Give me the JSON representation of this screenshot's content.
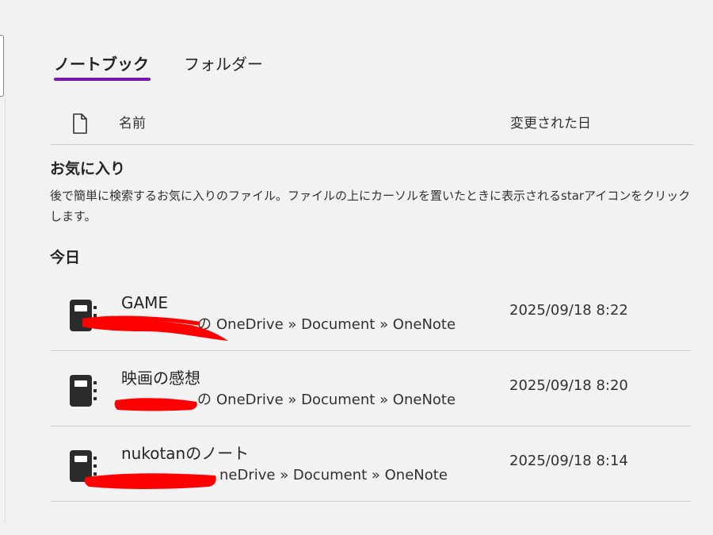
{
  "tabs": [
    {
      "label": "ノートブック",
      "active": true
    },
    {
      "label": "フォルダー",
      "active": false
    }
  ],
  "table_header": {
    "type_icon": "document-icon",
    "name_label": "名前",
    "date_label": "変更された日"
  },
  "favorites": {
    "title": "お気に入り",
    "description": "後で簡単に検索するお気に入りのファイル。ファイルの上にカーソルを置いたときに表示されるstarアイコンをクリックします。"
  },
  "today": {
    "title": "今日"
  },
  "notebooks": [
    {
      "name": "GAME",
      "path_owner_suffix": "の",
      "path": "OneDrive » Document » OneNote",
      "modified": "2025/09/18 8:22",
      "icon": "notebook-icon"
    },
    {
      "name": "映画の感想",
      "path_owner_suffix": "の",
      "path": "OneDrive » Document » OneNote",
      "modified": "2025/09/18 8:20",
      "icon": "notebook-icon"
    },
    {
      "name": "nukotanのノート",
      "path_owner_suffix": "",
      "path": "neDrive » Document » OneNote",
      "modified": "2025/09/18 8:14",
      "icon": "notebook-icon"
    }
  ],
  "colors": {
    "accent": "#7719aa",
    "redaction": "#ff0000",
    "background": "#f3f2f3"
  }
}
